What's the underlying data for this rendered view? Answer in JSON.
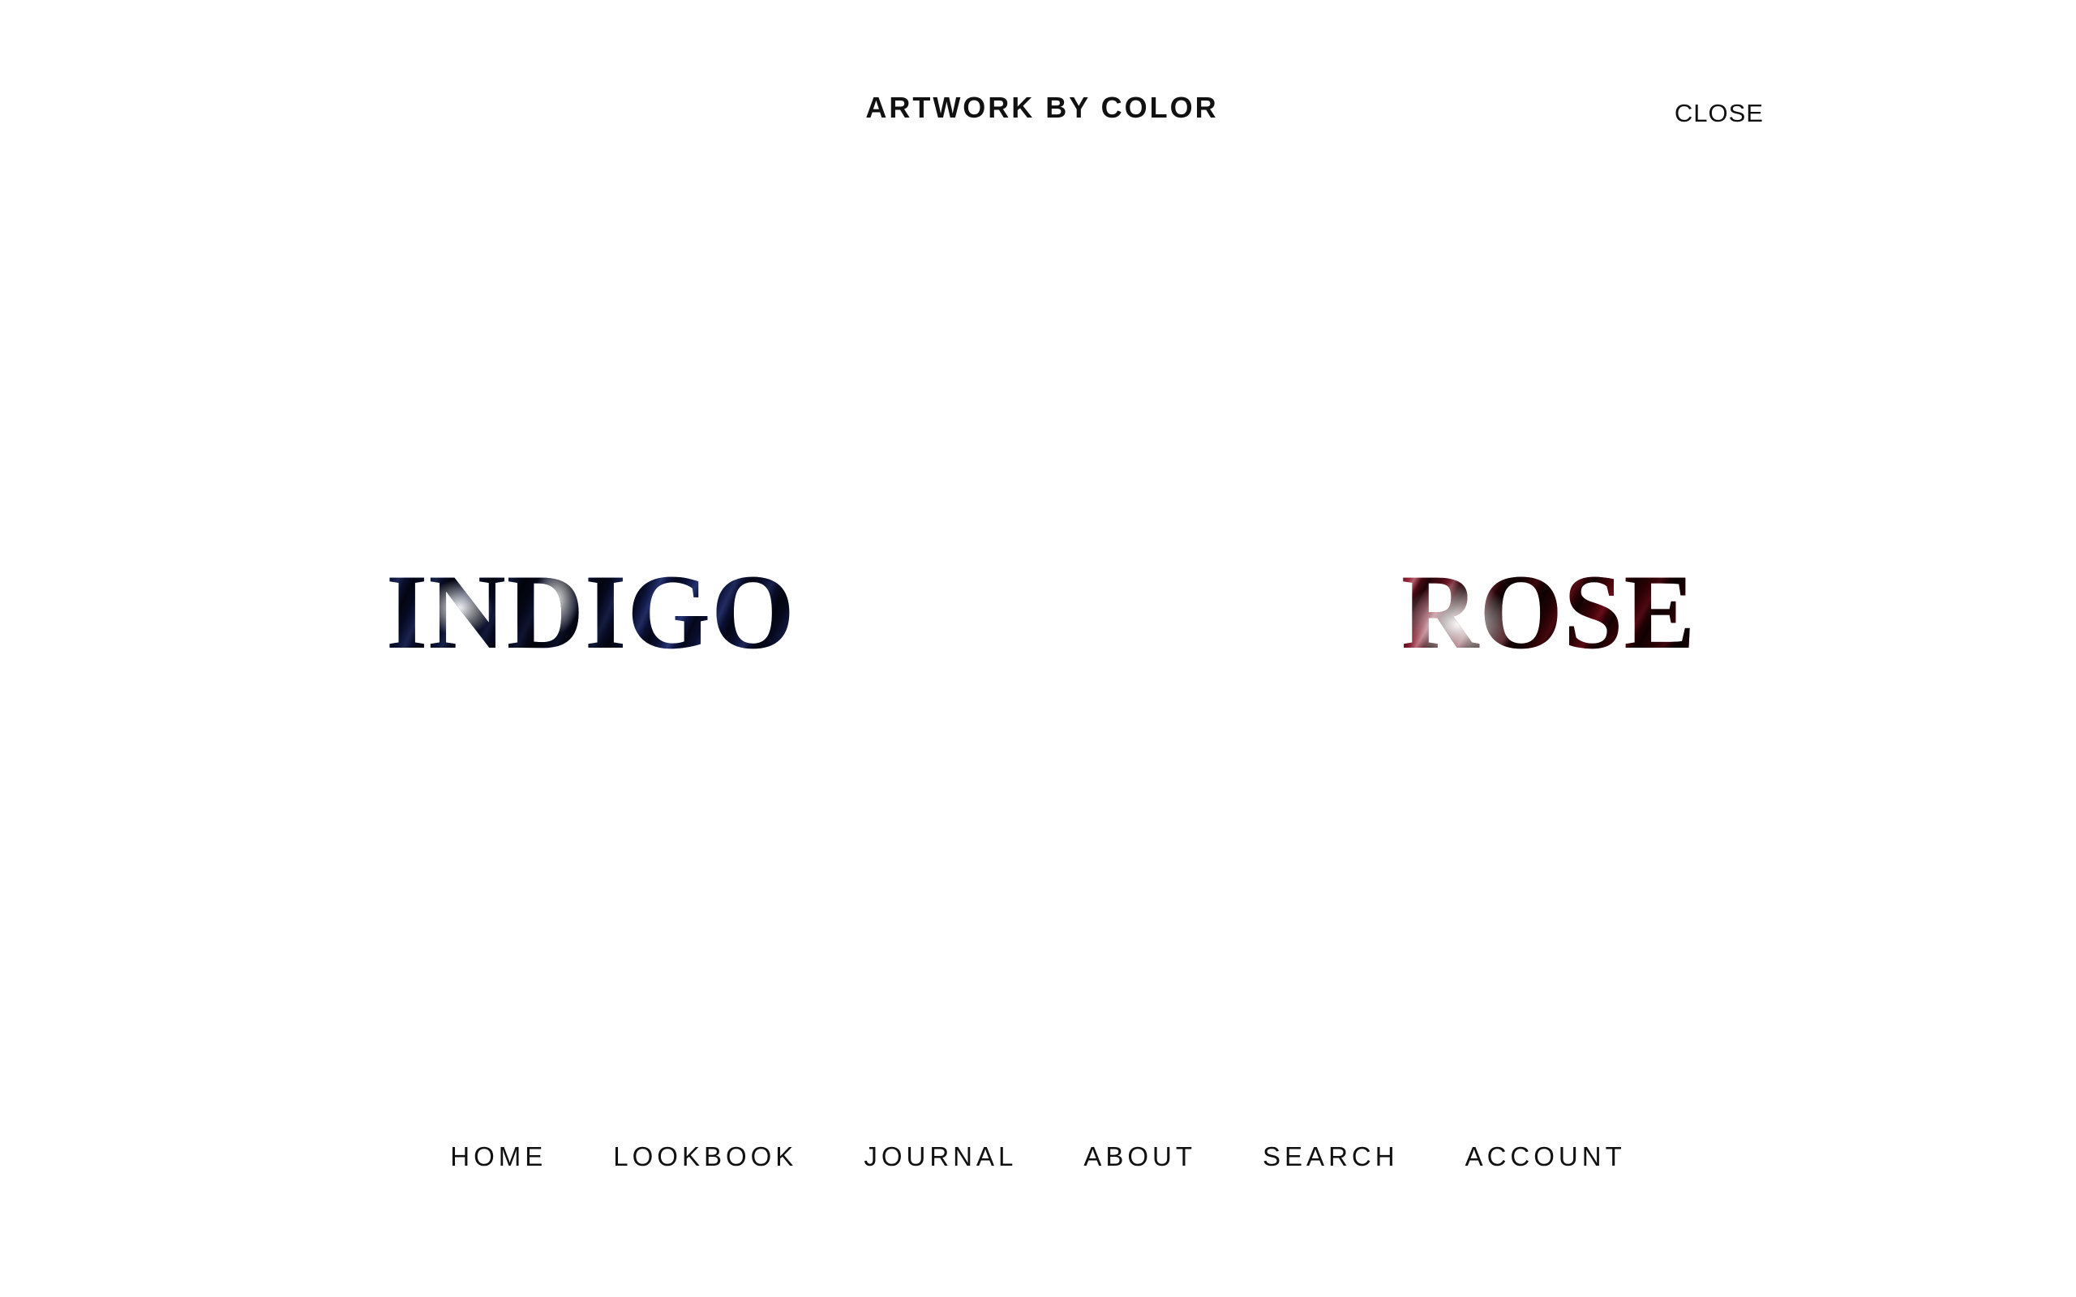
{
  "header": {
    "title": "ARTWORK BY COLOR",
    "close_label": "CLOSE"
  },
  "colors": [
    {
      "label": "INDIGO",
      "accent": "#2a3560"
    },
    {
      "label": "ROSE",
      "accent": "#7e1a2c"
    }
  ],
  "nav": {
    "items": [
      {
        "label": "HOME"
      },
      {
        "label": "LOOKBOOK"
      },
      {
        "label": "JOURNAL"
      },
      {
        "label": "ABOUT"
      },
      {
        "label": "SEARCH"
      },
      {
        "label": "ACCOUNT"
      }
    ]
  }
}
